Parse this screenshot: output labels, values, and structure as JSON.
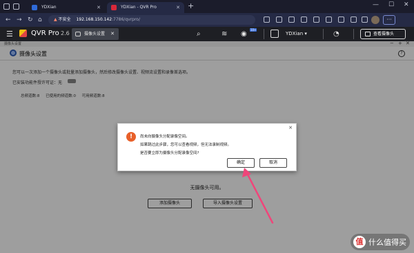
{
  "browser": {
    "tabs": [
      {
        "title": "YDXian",
        "active": false
      },
      {
        "title": "YDXian - QVR Pro",
        "active": true
      }
    ],
    "address": {
      "security_label": "不安全",
      "host": "192.168.150.142",
      "path": ":7786/qvrpro/"
    },
    "colors": {
      "tabbar": "#1b1c2b",
      "addressbar": "#252a45"
    }
  },
  "app": {
    "name": "QVR Pro",
    "version": "2.6",
    "open_tab": "摄像头设置",
    "badge": "10+",
    "username": "YDXian ▾",
    "view_cameras_label": "查看摄像头"
  },
  "window": {
    "breadcrumb": "摄像头设置",
    "title": "摄像头设置",
    "help": "?",
    "description": "您可以一次添加一个摄像头或批量添加摄像头，然后修改摄像头设置、视频流设置和录像首选项。",
    "license_text": "已安装功能件授许可证：无",
    "quota": {
      "total": "总频道数:8",
      "used": "已使用的频道数:0",
      "available": "可用频道数:8"
    },
    "empty_text": "无摄像头可用。",
    "add_camera_label": "添加摄像头",
    "import_settings_label": "导入摄像头设置"
  },
  "dialog": {
    "warning_glyph": "!",
    "lines": [
      "尚未向摄像头分配录像空间。",
      "如果跳过此步骤，您可以查看视频，但无法录制视频。",
      "是否要立即为摄像头分配录像空间?"
    ],
    "ok_label": "确定",
    "cancel_label": "取消",
    "accent_color": "#e8602a"
  },
  "annotation": {
    "arrow_color": "#f0457a"
  },
  "watermark": {
    "glyph": "值",
    "text": "什么值得买"
  }
}
